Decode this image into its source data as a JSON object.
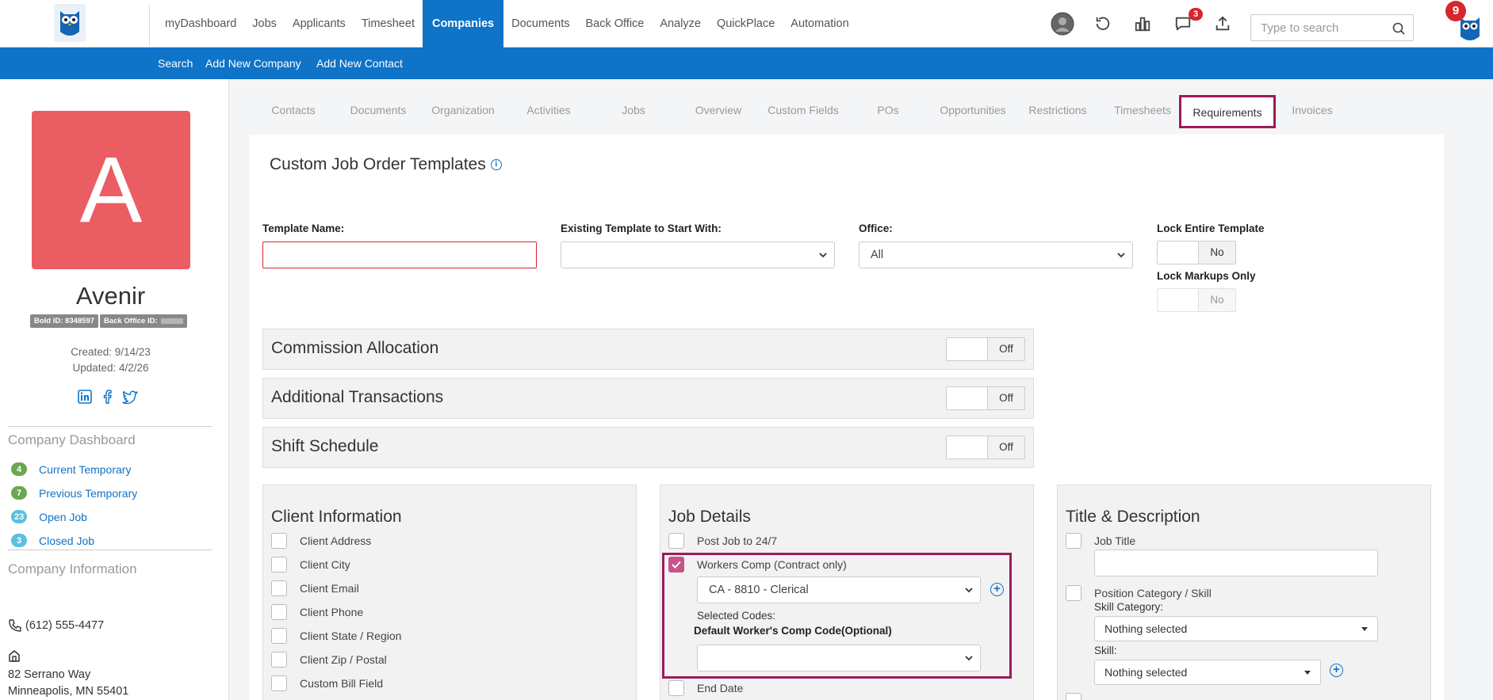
{
  "topnav": {
    "items": [
      "myDashboard",
      "Jobs",
      "Applicants",
      "Timesheet",
      "Companies",
      "Documents",
      "Back Office",
      "Analyze",
      "QuickPlace",
      "Automation"
    ],
    "active": "Companies",
    "search_placeholder": "Type to search",
    "messages_badge": "3",
    "notifications_badge": "9"
  },
  "subnav": {
    "search": "Search",
    "add_company": "Add New Company",
    "add_contact": "Add New Contact"
  },
  "sidebar": {
    "avatar_letter": "A",
    "company_name": "Avenir",
    "bold_id": "Bold ID: 8348597",
    "back_office_id": "Back Office ID:",
    "created": "Created: 9/14/23",
    "updated": "Updated: 4/2/26",
    "dashboard_title": "Company Dashboard",
    "dashboard": [
      {
        "count": "4",
        "label": "Current Temporary",
        "color": "#6aa84f"
      },
      {
        "count": "7",
        "label": "Previous Temporary",
        "color": "#6aa84f"
      },
      {
        "count": "23",
        "label": "Open Job",
        "color": "#5bc0de"
      },
      {
        "count": "3",
        "label": "Closed Job",
        "color": "#5bc0de"
      }
    ],
    "info_title": "Company Information",
    "phone": "(612) 555-4477",
    "address_line1": "82 Serrano Way",
    "address_line2": "Minneapolis, MN 55401"
  },
  "tabs": [
    "Contacts",
    "Documents",
    "Organization",
    "Activities",
    "Jobs",
    "Overview",
    "Custom Fields",
    "POs",
    "Opportunities",
    "Restrictions",
    "Timesheets",
    "Requirements",
    "Invoices"
  ],
  "active_tab": "Requirements",
  "main": {
    "title": "Custom Job Order Templates",
    "info_glyph": "i",
    "template_name_label": "Template Name:",
    "template_name_value": "",
    "existing_template_label": "Existing Template to Start With:",
    "existing_template_value": "",
    "office_label": "Office:",
    "office_value": "All",
    "lock_entire_label": "Lock Entire Template",
    "lock_entire_value": "No",
    "lock_markups_label": "Lock Markups Only",
    "lock_markups_value": "No",
    "accordions": [
      {
        "title": "Commission Allocation",
        "toggle": "Off"
      },
      {
        "title": "Additional Transactions",
        "toggle": "Off"
      },
      {
        "title": "Shift Schedule",
        "toggle": "Off"
      }
    ]
  },
  "client_info": {
    "title": "Client Information",
    "items": [
      "Client Address",
      "Client City",
      "Client Email",
      "Client Phone",
      "Client State / Region",
      "Client Zip / Postal",
      "Custom Bill Field"
    ]
  },
  "job_details": {
    "title": "Job Details",
    "post_job": "Post Job to 24/7",
    "workers_comp": "Workers Comp (Contract only)",
    "workers_comp_checked": true,
    "wc_code_value": "CA - 8810 - Clerical",
    "selected_codes": "Selected Codes:",
    "default_code_label": "Default Worker's Comp Code(Optional)",
    "default_code_value": "",
    "end_date": "End Date"
  },
  "title_desc": {
    "title": "Title & Description",
    "job_title": "Job Title",
    "job_title_value": "",
    "position_category": "Position Category / Skill",
    "skill_category_label": "Skill Category:",
    "skill_category_value": "Nothing selected",
    "skill_label": "Skill:",
    "skill_value": "Nothing selected"
  }
}
